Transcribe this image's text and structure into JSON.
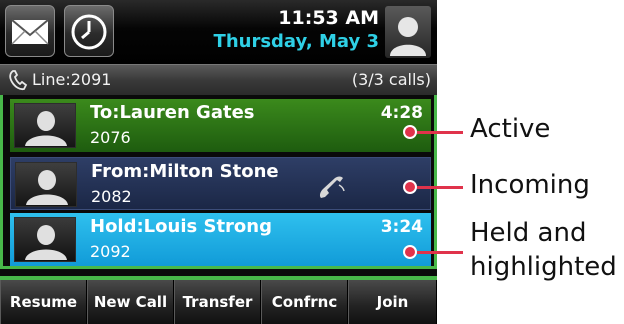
{
  "header": {
    "message_icon": "envelope-icon",
    "clock_icon": "clock-icon",
    "time": "11:53 AM",
    "date": "Thursday, May 3",
    "user_icon": "user-icon"
  },
  "line": {
    "icon": "phone-handset-icon",
    "label": "Line:2091",
    "calls": "(3/3 calls)"
  },
  "calls": [
    {
      "state": "active",
      "name": "To:Lauren Gates",
      "number": "2076",
      "timer": "4:28"
    },
    {
      "state": "incoming",
      "name": "From:Milton Stone",
      "number": "2082",
      "timer": "",
      "icon": "ringing-handset-icon"
    },
    {
      "state": "held",
      "name": "Hold:Louis Strong",
      "number": "2092",
      "timer": "3:24"
    }
  ],
  "softkeys": [
    "Resume",
    "New Call",
    "Transfer",
    "Confrnc",
    "Join"
  ],
  "callouts": {
    "active": "Active",
    "incoming": "Incoming",
    "held_line1": "Held and",
    "held_line2": "highlighted"
  },
  "colors": {
    "active_row": "#2e7a17",
    "incoming_row": "#24335a",
    "held_row": "#1fb0e6",
    "accent_green": "#48b84a",
    "date_cyan": "#2fd0e6",
    "callout_red": "#e0334b"
  }
}
